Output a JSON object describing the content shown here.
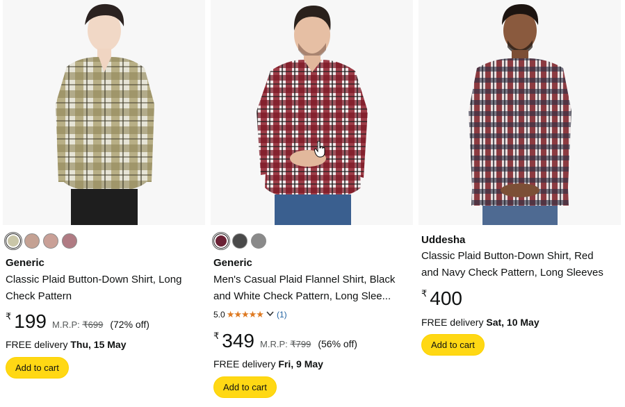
{
  "colors": {
    "price_text": "#0f1111",
    "star": "#de7921",
    "link": "#2162a1",
    "button_bg": "#ffd814",
    "muted": "#565959"
  },
  "products": [
    {
      "brand": "Generic",
      "title_line1": "Classic Plaid Button-Down Shirt, Long",
      "title_line2": "Check Pattern",
      "swatches": [
        "#c9c6a8",
        "#c4a193",
        "#c9a097",
        "#b07b83"
      ],
      "currency": "₹",
      "price": "199",
      "mrp_label": "M.R.P:",
      "mrp_value": "₹699",
      "discount": "(72% off)",
      "delivery_label": "FREE delivery",
      "delivery_date": "Thu, 15 May",
      "cart_label": "Add to cart"
    },
    {
      "brand": "Generic",
      "title_line1": "Men's Casual Plaid Flannel Shirt, Black",
      "title_line2": "and White Check Pattern, Long Slee...",
      "swatches": [
        "#6b2235",
        "#4a4a4a",
        "#8a8a8a"
      ],
      "rating_value": "5.0",
      "rating_stars": "★★★★★",
      "rating_count": "(1)",
      "currency": "₹",
      "price": "349",
      "mrp_label": "M.R.P:",
      "mrp_value": "₹799",
      "discount": "(56% off)",
      "delivery_label": "FREE delivery",
      "delivery_date": "Fri, 9 May",
      "cart_label": "Add to cart"
    },
    {
      "brand": "Uddesha",
      "title_line1": "Classic Plaid Button-Down Shirt, Red",
      "title_line2": "and Navy Check Pattern, Long Sleeves",
      "currency": "₹",
      "price": "400",
      "delivery_label": "FREE delivery",
      "delivery_date": "Sat, 10 May",
      "cart_label": "Add to cart"
    }
  ]
}
